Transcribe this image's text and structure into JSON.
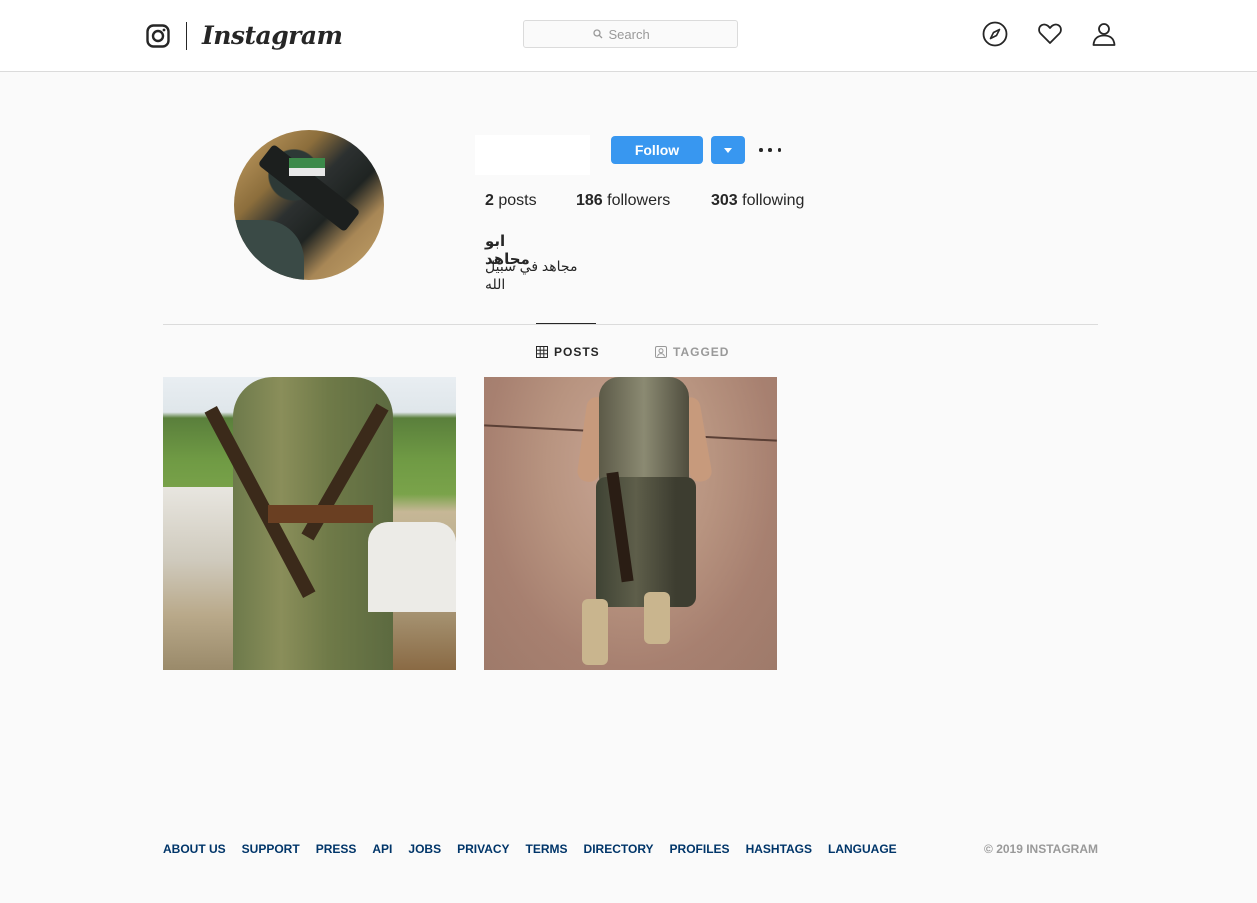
{
  "nav": {
    "wordmark": "Instagram",
    "search": {
      "placeholder": "Search"
    }
  },
  "profile": {
    "follow_label": "Follow",
    "stats": {
      "posts_count": "2",
      "posts_label": "posts",
      "followers_count": "186",
      "followers_label": "followers",
      "following_count": "303",
      "following_label": "following"
    },
    "full_name": "ابو مجاهد",
    "bio": "مجاهد في سبيل الله"
  },
  "tabs": [
    {
      "label": "POSTS",
      "active": true,
      "icon": "grid-icon"
    },
    {
      "label": "TAGGED",
      "active": false,
      "icon": "tagged-icon"
    }
  ],
  "footer": {
    "links": [
      "ABOUT US",
      "SUPPORT",
      "PRESS",
      "API",
      "JOBS",
      "PRIVACY",
      "TERMS",
      "DIRECTORY",
      "PROFILES",
      "HASHTAGS",
      "LANGUAGE"
    ],
    "copyright": "© 2019 INSTAGRAM"
  },
  "colors": {
    "accent": "#3897f0",
    "footer_link": "#003569",
    "border": "#dbdbdb",
    "background": "#fafafa"
  }
}
